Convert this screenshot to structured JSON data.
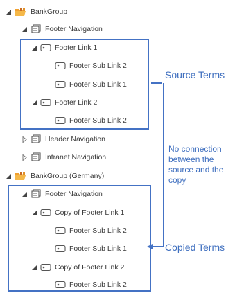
{
  "tree": [
    {
      "label": "BankGroup",
      "icon": "termset-folder-icon",
      "expander": "expanded"
    },
    {
      "label": "Footer Navigation",
      "icon": "termset-icon",
      "expander": "expanded"
    },
    {
      "label": "Footer Link 1",
      "icon": "term-icon",
      "expander": "expanded"
    },
    {
      "label": "Footer Sub Link 2",
      "icon": "term-icon",
      "expander": "none"
    },
    {
      "label": "Footer Sub Link 1",
      "icon": "term-icon",
      "expander": "none"
    },
    {
      "label": "Footer Link 2",
      "icon": "term-icon",
      "expander": "expanded"
    },
    {
      "label": "Footer Sub Link 2",
      "icon": "term-icon",
      "expander": "none"
    },
    {
      "label": "Header Navigation",
      "icon": "termset-icon",
      "expander": "collapsed"
    },
    {
      "label": "Intranet Navigation",
      "icon": "termset-icon",
      "expander": "collapsed"
    },
    {
      "label": "BankGroup (Germany)",
      "icon": "termset-folder-icon",
      "expander": "expanded"
    },
    {
      "label": "Footer Navigation",
      "icon": "termset-icon",
      "expander": "expanded"
    },
    {
      "label": "Copy of Footer Link 1",
      "icon": "term-icon",
      "expander": "expanded"
    },
    {
      "label": "Footer Sub Link 2",
      "icon": "term-icon",
      "expander": "none"
    },
    {
      "label": "Footer Sub Link 1",
      "icon": "term-icon",
      "expander": "none"
    },
    {
      "label": "Copy of Footer Link 2",
      "icon": "term-icon",
      "expander": "expanded"
    },
    {
      "label": "Footer Sub Link 2",
      "icon": "term-icon",
      "expander": "none"
    }
  ],
  "annotations": {
    "source_terms": "Source Terms",
    "copied_terms": "Copied Terms",
    "no_connection": "No connection between the source and the copy"
  },
  "colors": {
    "accent": "#4472c4",
    "annotation_text": "#3f6fbf",
    "folder_orange": "#f0a030",
    "icon_gray": "#555555"
  }
}
